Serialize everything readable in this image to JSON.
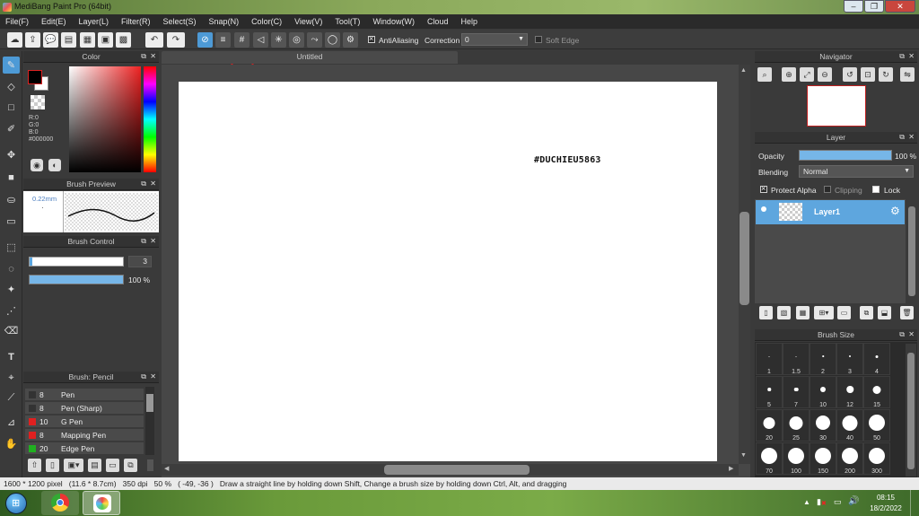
{
  "window": {
    "title": "MediBang Paint Pro (64bit)",
    "minimize": "–",
    "maximize": "❐",
    "close": "✕"
  },
  "menu": [
    "File(F)",
    "Edit(E)",
    "Layer(L)",
    "Filter(R)",
    "Select(S)",
    "Snap(N)",
    "Color(C)",
    "View(V)",
    "Tool(T)",
    "Window(W)",
    "Cloud",
    "Help"
  ],
  "toolbar": {
    "antialiasing_label": "AntiAliasing",
    "correction_label": "Correction",
    "correction_value": "0",
    "soft_edge_label": "Soft Edge"
  },
  "panels": {
    "color": {
      "title": "Color",
      "r": "R:0",
      "g": "G:0",
      "b": "B:0",
      "hex": "#000000"
    },
    "brush_preview": {
      "title": "Brush Preview",
      "size": "0.22mm",
      "dot": "·"
    },
    "brush_control": {
      "title": "Brush Control",
      "size_value": "3",
      "opacity_value": "100 %",
      "opacity_fraction": 1.0,
      "size_fraction": 0.03
    },
    "brush_list": {
      "title": "Brush: Pencil",
      "items": [
        {
          "size": "8",
          "name": "Pen",
          "color": "#333333"
        },
        {
          "size": "8",
          "name": "Pen (Sharp)",
          "color": "#333333"
        },
        {
          "size": "10",
          "name": "G Pen",
          "color": "#e02020"
        },
        {
          "size": "8",
          "name": "Mapping Pen",
          "color": "#e02020"
        },
        {
          "size": "20",
          "name": "Edge Pen",
          "color": "#20b020"
        }
      ]
    },
    "navigator": {
      "title": "Navigator"
    },
    "layer": {
      "title": "Layer",
      "opacity_label": "Opacity",
      "opacity_value": "100 %",
      "opacity_fraction": 1.0,
      "blending_label": "Blending",
      "blending_value": "Normal",
      "protect_alpha": "Protect Alpha",
      "clipping": "Clipping",
      "lock": "Lock",
      "layer_name": "Layer1"
    },
    "brush_size": {
      "title": "Brush Size",
      "sizes": [
        "1",
        "1.5",
        "2",
        "3",
        "4",
        "5",
        "7",
        "10",
        "12",
        "15",
        "20",
        "25",
        "30",
        "40",
        "50",
        "70",
        "100",
        "150",
        "200",
        "300"
      ]
    }
  },
  "canvas": {
    "tab_title": "Untitled",
    "watermark": "#DUCHIEU5863"
  },
  "status": {
    "dimensions": "1600 * 1200 pixel",
    "physical_size": "(11.6 * 8.7cm)",
    "dpi": "350 dpi",
    "zoom": "50 %",
    "coords": "( -49, -36 )",
    "hint": "Draw a straight line by holding down Shift, Change a brush size by holding down Ctrl, Alt, and dragging"
  },
  "taskbar": {
    "time": "08:15",
    "date": "18/2/2022"
  }
}
